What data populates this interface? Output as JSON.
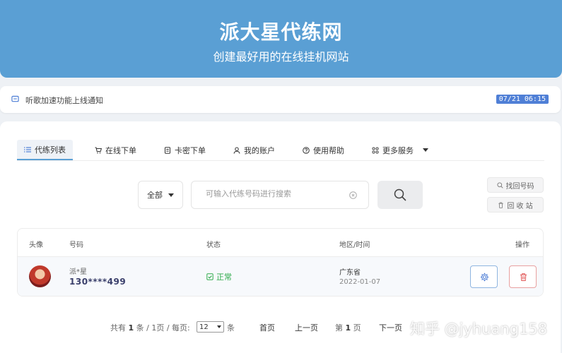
{
  "header": {
    "title": "派大星代练网",
    "subtitle": "创建最好用的在线挂机网站",
    "background": "#5a9fd4"
  },
  "notice": {
    "icon": "message-icon",
    "text": "听歌加速功能上线通知",
    "time": "07/21 06:15"
  },
  "tabs": [
    {
      "label": "代练列表",
      "icon": "list-icon",
      "active": true
    },
    {
      "label": "在线下单",
      "icon": "cart-icon"
    },
    {
      "label": "卡密下单",
      "icon": "card-icon"
    },
    {
      "label": "我的账户",
      "icon": "user-icon"
    },
    {
      "label": "使用帮助",
      "icon": "help-icon"
    },
    {
      "label": "更多服务",
      "icon": "grid-icon"
    }
  ],
  "search": {
    "filter_value": "全部",
    "placeholder": "可输入代练号码进行搜索"
  },
  "side_buttons": {
    "find": "找回号码",
    "recycle": "回 收 站"
  },
  "table": {
    "headers": {
      "avatar": "头像",
      "account": "号码",
      "status": "状态",
      "region": "地区/时间",
      "actions": "操作"
    },
    "rows": [
      {
        "name": "派*星",
        "number": "130****499",
        "status": "正常",
        "region": "广东省",
        "date": "2022-01-07"
      }
    ]
  },
  "pagination": {
    "summary_prefix": "共有",
    "total": "1",
    "summary_mid": "条 / 1页 / 每页:",
    "page_size": "12",
    "summary_suffix": "条",
    "first": "首页",
    "prev": "上一页",
    "current_prefix": "第",
    "current": "1",
    "current_suffix": "页",
    "next": "下一页"
  },
  "watermark": "知乎 @jyhuang158",
  "colors": {
    "accent": "#5a9fd4",
    "time_badge": "#4f7fd6",
    "status_ok": "#2eaa4a",
    "delete": "#e05555"
  }
}
